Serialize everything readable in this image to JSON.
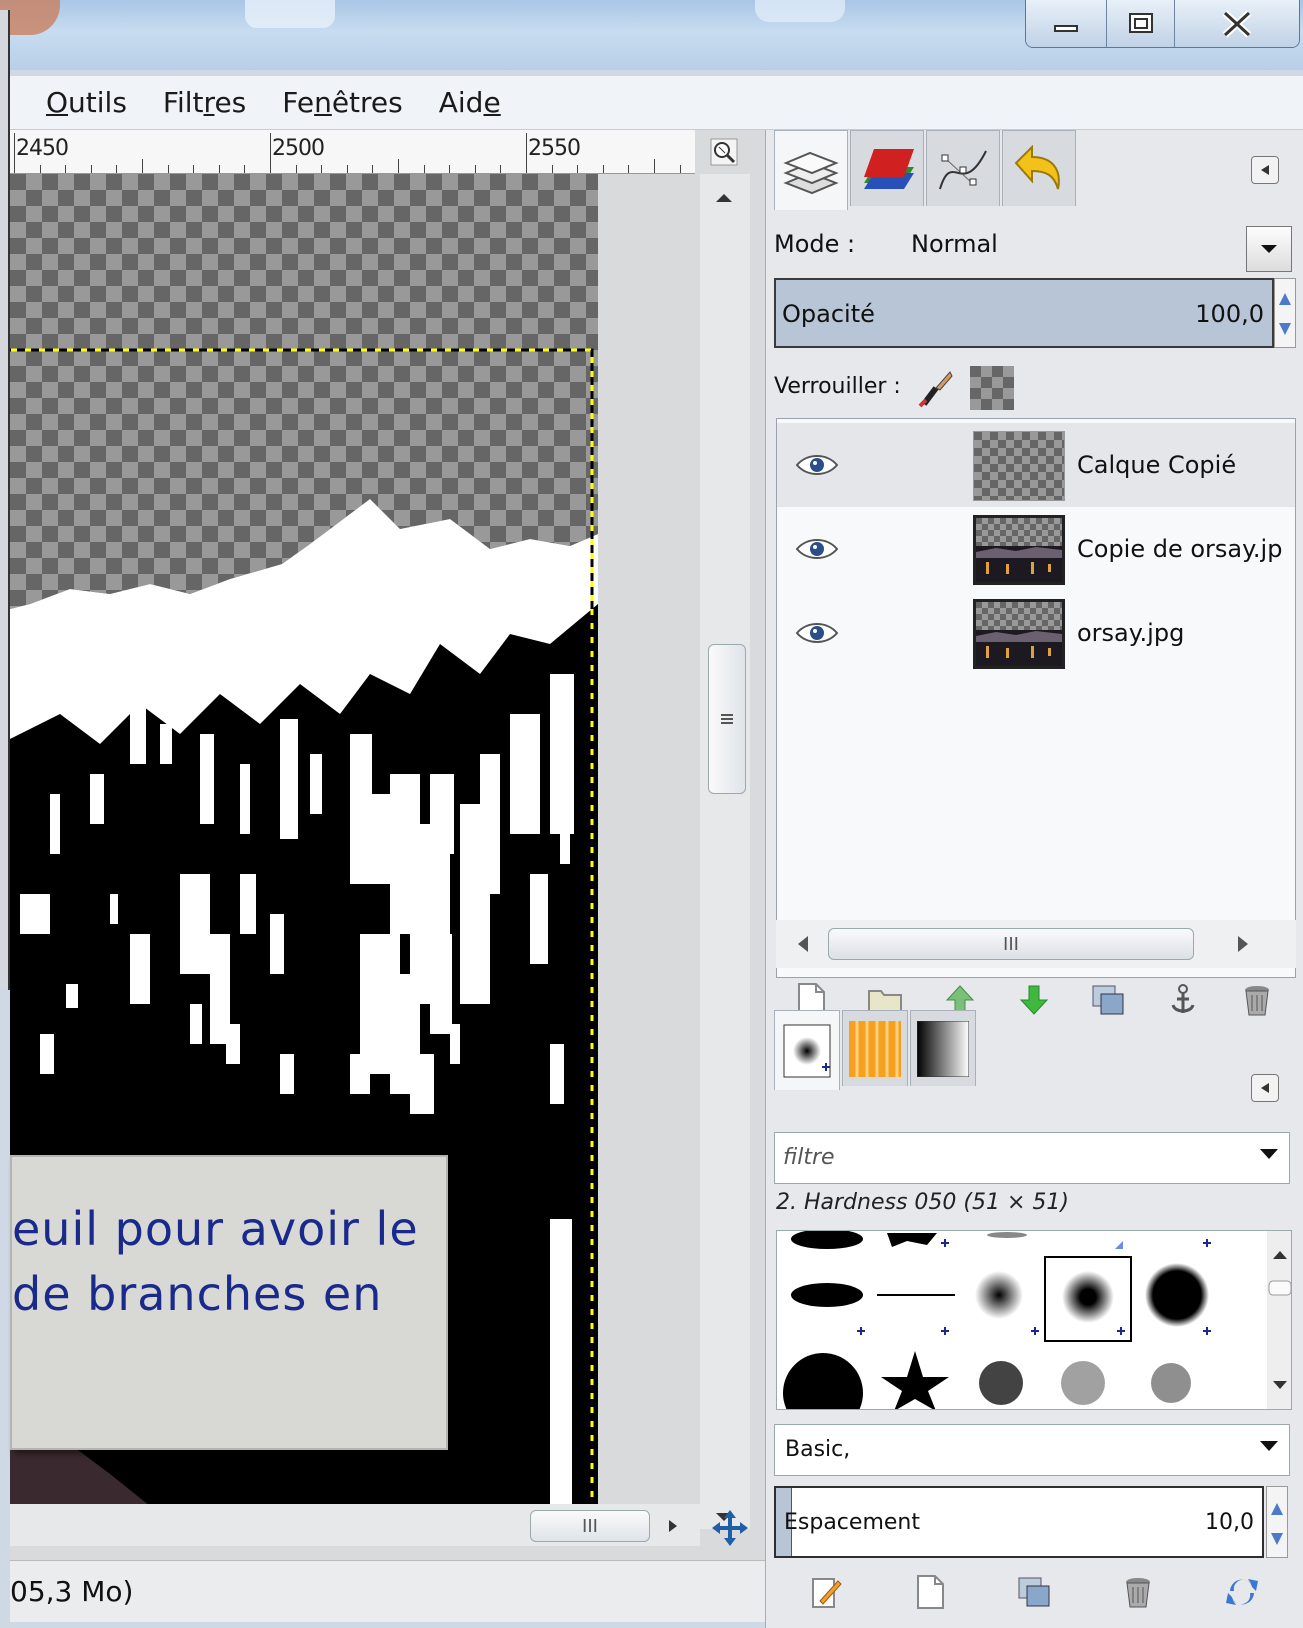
{
  "window": {
    "buttons": [
      {
        "name": "minimize-button",
        "icon": "minimize-icon"
      },
      {
        "name": "maximize-button",
        "icon": "maximize-icon"
      },
      {
        "name": "close-button",
        "icon": "close-icon"
      }
    ]
  },
  "menubar": {
    "items": [
      {
        "name": "menu-outils",
        "pre": "",
        "u": "O",
        "post": "utils"
      },
      {
        "name": "menu-filtres",
        "pre": "Filt",
        "u": "r",
        "post": "es"
      },
      {
        "name": "menu-fenetres",
        "pre": "Fe",
        "u": "n",
        "post": "êtres"
      },
      {
        "name": "menu-aide",
        "pre": "Aid",
        "u": "e",
        "post": ""
      }
    ]
  },
  "ruler": {
    "labels": [
      "2450",
      "2500",
      "2550"
    ]
  },
  "canvas": {
    "tooltip_line1": "euil pour avoir le",
    "tooltip_line2": "de branches en"
  },
  "statusbar": {
    "text": "05,3 Mo)"
  },
  "layers_panel": {
    "mode_label": "Mode :",
    "mode_value": "Normal",
    "opacity_label": "Opacité",
    "opacity_value": "100,0",
    "lock_label": "Verrouiller :",
    "layers": [
      {
        "name": "Calque Copié",
        "visible": true,
        "thumb": "transparent",
        "selected": true
      },
      {
        "name": "Copie de orsay.jp",
        "visible": true,
        "thumb": "photo",
        "selected": false
      },
      {
        "name": "orsay.jpg",
        "visible": true,
        "thumb": "photo",
        "selected": false
      }
    ],
    "buttons": [
      "new-layer-icon",
      "new-group-icon",
      "raise-layer-icon",
      "lower-layer-icon",
      "duplicate-layer-icon",
      "anchor-layer-icon",
      "delete-layer-icon"
    ]
  },
  "brushes_panel": {
    "filter_placeholder": "filtre",
    "brush_name": "2. Hardness 050 (51 × 51)",
    "tag_value": "Basic,",
    "spacing_label": "Espacement",
    "spacing_value": "10,0",
    "buttons": [
      "edit-brush-icon",
      "new-brush-icon",
      "duplicate-brush-icon",
      "delete-brush-icon",
      "refresh-brushes-icon"
    ]
  },
  "colors": {
    "accent": "#1a2a8c",
    "selection": "#b7c5d6",
    "marching_ants": "#ffff00"
  }
}
